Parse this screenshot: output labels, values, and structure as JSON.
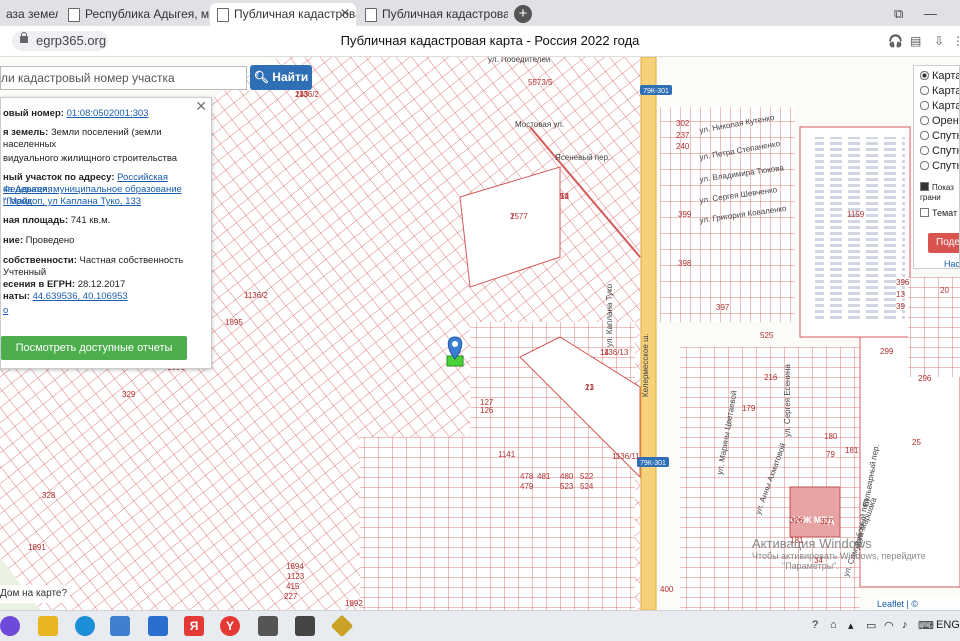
{
  "browser": {
    "tabs": [
      {
        "label": "аза земель"
      },
      {
        "label": "Республика Адыгея, муни"
      },
      {
        "label": "Публичная кадастрова"
      },
      {
        "label": "Публичная кадастровая к"
      }
    ],
    "url": "egrp365.org",
    "page_title": "Публичная кадастровая карта - Россия 2022 года"
  },
  "search": {
    "placeholder": "ли кадастровый номер участка",
    "button_label": "Найти"
  },
  "popup": {
    "cad_label": "овый номер:",
    "cad_value": "01:08:0502001:303",
    "cat_label": "я земель:",
    "cat_value": "Земли поселений (земли населенных",
    "use_value": "видуального жилищного строительства",
    "addr_label": "ный участок по адресу:",
    "addr_line1": "Российская Федерация,",
    "addr_line2": "ка Адыгея, муниципальное образование \"Город",
    "addr_line3": "г Майкоп, ул Каплана Туко, 133",
    "area_label": "ная площадь:",
    "area_value": "741 кв.м.",
    "survey_label": "ние:",
    "survey_value": "Проведено",
    "own_label": "собственности:",
    "own_value": "Частная собственность",
    "status_value": "Учтенный",
    "date_label": "есения в ЕГРН:",
    "date_value": "28.12.2017",
    "coord_label": "наты:",
    "coord_value": "44.639536, 40.106953",
    "more_link": "о",
    "report_button": "Посмотреть доступные отчеты"
  },
  "layers": {
    "options": [
      "Карта",
      "Карта",
      "Карта",
      "Орент",
      "Спутн",
      "Спутн",
      "Спутн"
    ],
    "selected_index": 0,
    "show_borders": "Показ грани",
    "thematic": "Темат",
    "share_button": "Подел",
    "settings_link": "Нас"
  },
  "map": {
    "street_labels": [
      "ул. Победителей",
      "Мостовая ул.",
      "Ясеневый пер.",
      "ул. Николая Кутенко",
      "ул. Петра Степаненко",
      "ул. Владимира Тюкова",
      "ул. Сергея Шевченко",
      "ул. Григория Коваленко",
      "Келермесское ш.",
      "ул. Сергея Есенина",
      "ул. Марины Цветаевой",
      "ул. Анны Ахматовой",
      "ул. Самуила Маршака",
      "Дубовый пер.",
      "Бульварный пер.",
      "ул. Каплана Туко"
    ],
    "road_badges": [
      "79К-301",
      "79К-301"
    ],
    "parcel_labels": [
      "1136/2",
      "1577",
      "54",
      "1136/13",
      "13",
      "127",
      "126",
      "1141",
      "1136/11",
      "478",
      "481",
      "479",
      "480",
      "522",
      "523",
      "524",
      "525",
      "5573/5",
      "1159",
      "296",
      "299",
      "25",
      "79",
      "180",
      "181",
      "179",
      "216",
      "181",
      "34",
      "326",
      "327",
      "328",
      "329",
      "1136/2",
      "1895",
      "1896",
      "1891",
      "1892",
      "1894",
      "1123",
      "415",
      "227",
      "400",
      "399",
      "398",
      "397",
      "396",
      "13",
      "39",
      "20",
      "302",
      "237",
      "240",
      "243",
      "2",
      "13",
      "14",
      "21"
    ],
    "marker_label": "303",
    "house_question": "Дом на карте?",
    "building_label": "СОЖ МВД",
    "activation_title": "Активация Windows",
    "activation_text1": "Чтобы активировать Windows, перейдите",
    "activation_text2": "\"Параметры\".",
    "attribution": "Leaflet | © Публичная"
  },
  "taskbar": {
    "lang": "ENG",
    "icons": [
      "cortana-icon",
      "explorer-icon",
      "edge-icon",
      "store-icon",
      "mail-icon",
      "yandex-icon",
      "yandex-browser-icon",
      "game1-icon",
      "game2-icon",
      "game3-icon"
    ]
  },
  "colors": {
    "parcel_line": "#d45a5a",
    "road_yellow": "#f6d27a",
    "road_badge": "#2f6fb5",
    "button_blue": "#2f6fb5",
    "button_green": "#4cae4c",
    "button_red": "#d9534f",
    "marker": "#3a7fd5"
  }
}
